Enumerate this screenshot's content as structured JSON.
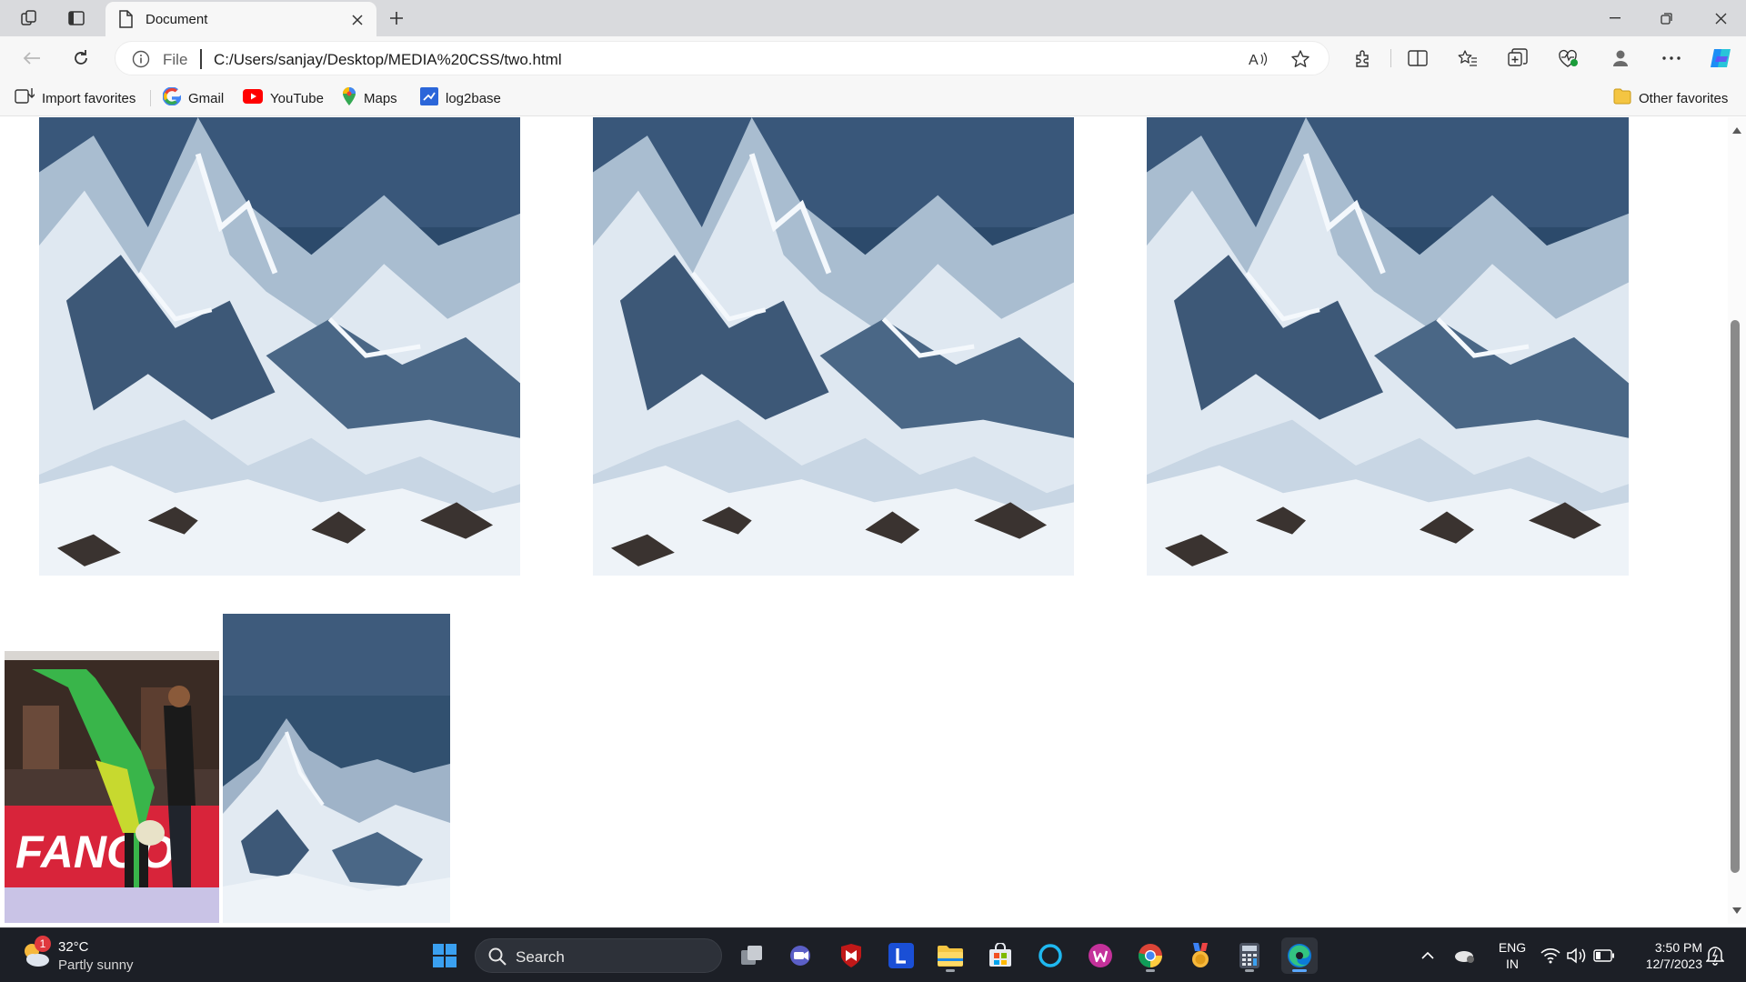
{
  "browser": {
    "tab_title": "Document",
    "address": {
      "scheme_label": "File",
      "url": "C:/Users/sanjay/Desktop/MEDIA%20CSS/two.html"
    }
  },
  "favorites": {
    "items": [
      {
        "label": "Import favorites",
        "icon": "import-icon"
      },
      {
        "label": "Gmail",
        "icon": "google-icon"
      },
      {
        "label": "YouTube",
        "icon": "youtube-icon"
      },
      {
        "label": "Maps",
        "icon": "maps-pin-icon"
      },
      {
        "label": "log2base",
        "icon": "log2base-icon"
      }
    ],
    "other": "Other favorites"
  },
  "page": {
    "images": [
      {
        "name": "mountain-image-1",
        "subject": "snowy mountain"
      },
      {
        "name": "mountain-image-2",
        "subject": "snowy mountain"
      },
      {
        "name": "mountain-image-3",
        "subject": "snowy mountain"
      },
      {
        "name": "kabaddi-image",
        "subject": "kabaddi player",
        "banner_text": "FANCO"
      },
      {
        "name": "mountain-image-4",
        "subject": "snowy mountain"
      }
    ]
  },
  "taskbar": {
    "weather": {
      "temp": "32°C",
      "condition": "Partly sunny",
      "badge": "1"
    },
    "search_label": "Search",
    "apps": [
      "task-view",
      "meet",
      "mcafee",
      "l-app",
      "file-explorer",
      "store",
      "cortana",
      "wps-office",
      "chrome",
      "medal-app",
      "calculator",
      "edge"
    ],
    "language": {
      "line1": "ENG",
      "line2": "IN"
    },
    "time": "3:50 PM",
    "date": "12/7/2023"
  },
  "colors": {
    "tabstrip": "#d9dadd",
    "toolbar": "#f7f7f7",
    "taskbar": "#1c1f26",
    "accent": "#0078d4"
  }
}
